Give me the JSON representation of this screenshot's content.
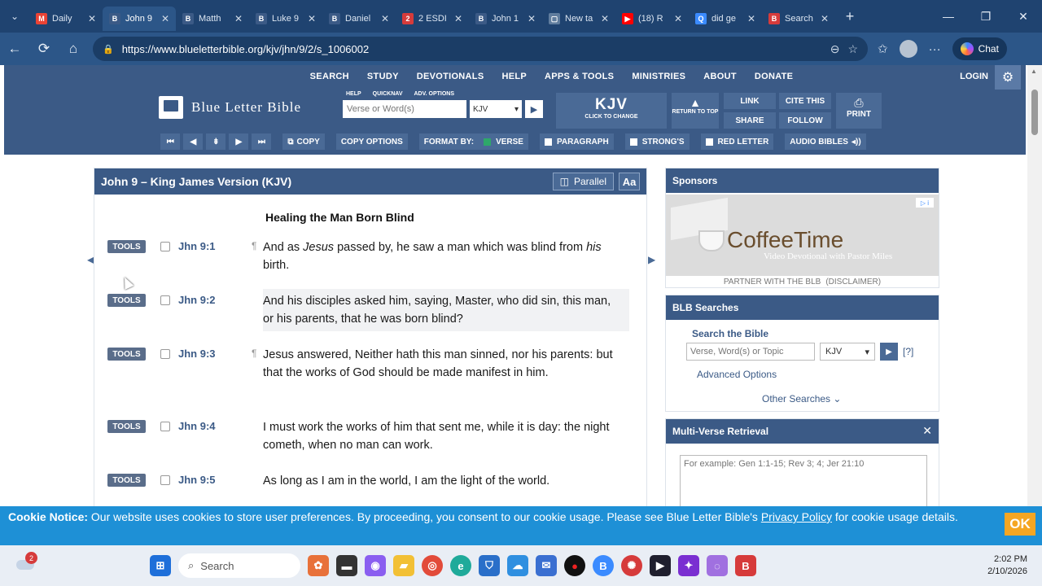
{
  "browser": {
    "tabs": [
      {
        "title": "Daily",
        "fav_color": "#ea4335",
        "fav_letter": "M"
      },
      {
        "title": "John 9",
        "fav_color": "#3b5a86",
        "fav_letter": "B",
        "active": true
      },
      {
        "title": "Matth",
        "fav_color": "#3b5a86",
        "fav_letter": "B"
      },
      {
        "title": "Luke 9",
        "fav_color": "#3b5a86",
        "fav_letter": "B"
      },
      {
        "title": "Daniel",
        "fav_color": "#3b5a86",
        "fav_letter": "B"
      },
      {
        "title": "2 ESDI",
        "fav_color": "#d63b3b",
        "fav_letter": "2"
      },
      {
        "title": "John 1",
        "fav_color": "#3b5a86",
        "fav_letter": "B"
      },
      {
        "title": "New ta",
        "fav_color": "#607d9e",
        "fav_letter": "▢"
      },
      {
        "title": "(18) R",
        "fav_color": "#ff0000",
        "fav_letter": "▶"
      },
      {
        "title": "did ge",
        "fav_color": "#3b8bff",
        "fav_letter": "Q"
      },
      {
        "title": "Search",
        "fav_color": "#d63b3b",
        "fav_letter": "B"
      }
    ],
    "url": "https://www.blueletterbible.org/kjv/jhn/9/2/s_1006002",
    "chat_label": "Chat"
  },
  "site": {
    "menu": [
      "SEARCH",
      "STUDY",
      "DEVOTIONALS",
      "HELP",
      "APPS & TOOLS",
      "MINISTRIES",
      "ABOUT",
      "DONATE"
    ],
    "login": "LOGIN",
    "logo_text": "Blue Letter Bible",
    "mini_links": [
      "HELP",
      "QUICKNAV",
      "ADV. OPTIONS"
    ],
    "verse_placeholder": "Verse or Word(s)",
    "version": "KJV",
    "kjv_big": "KJV",
    "kjv_small": "CLICK TO CHANGE",
    "return_top": "RETURN TO TOP",
    "link": "LINK",
    "cite": "CITE THIS",
    "share": "SHARE",
    "follow": "FOLLOW",
    "print": "PRINT",
    "toolbar": {
      "copy": "COPY",
      "copy_options": "COPY OPTIONS",
      "format_by": "FORMAT BY:",
      "verse": "VERSE",
      "paragraph": "PARAGRAPH",
      "strongs": "STRONG'S",
      "red_letter": "RED LETTER",
      "audio_bibles": "AUDIO BIBLES"
    }
  },
  "panel": {
    "title": "John 9 – King James Version (KJV)",
    "parallel": "Parallel",
    "aa": "Aa",
    "heading": "Healing the Man Born Blind",
    "tools_label": "TOOLS",
    "verses": [
      {
        "ref": "Jhn 9:1",
        "pilcrow": true,
        "html": "And as <i>Jesus</i> passed by, he saw a man which was blind from <i>his</i> birth.",
        "highlight": false
      },
      {
        "ref": "Jhn 9:2",
        "pilcrow": false,
        "html": "And his disciples asked him, saying, Master, who did sin, this man, or his parents, that he was born blind?",
        "highlight": true
      },
      {
        "ref": "Jhn 9:3",
        "pilcrow": true,
        "html": "Jesus answered, Neither hath this man sinned, nor his parents: but that the works of God should be made manifest in him.",
        "highlight": false
      },
      {
        "ref": "Jhn 9:4",
        "pilcrow": false,
        "html": "I must work the works of him that sent me, while it is day: the night cometh, when no man can work.",
        "highlight": false
      },
      {
        "ref": "Jhn 9:5",
        "pilcrow": false,
        "html": "As long as I am in the world, I am the light of the world.",
        "highlight": false
      }
    ]
  },
  "sidebar": {
    "sponsors": "Sponsors",
    "ad_title": "CoffeeTime",
    "ad_sub": "Video Devotional with Pastor Miles",
    "partner": "PARTNER WITH THE BLB",
    "disclaimer": "(DISCLAIMER)",
    "searches_title": "BLB Searches",
    "search_label": "Search the Bible",
    "search_placeholder": "Verse, Word(s) or Topic",
    "search_version": "KJV",
    "help": "[?]",
    "advanced": "Advanced Options",
    "other": "Other Searches",
    "mv_title": "Multi-Verse Retrieval",
    "mv_placeholder": "For example: Gen 1:1-15; Rev 3; 4; Jer 21:10"
  },
  "cookie": {
    "label": "Cookie Notice:",
    "text": " Our website uses cookies to store user preferences. By proceeding, you consent to our cookie usage. Please see Blue Letter Bible's ",
    "link": "Privacy Policy",
    "tail": " for cookie usage details.",
    "ok": "OK"
  },
  "taskbar": {
    "weather_badge": "2",
    "search": "Search",
    "time": "2:02 PM",
    "date": "2/10/2026"
  }
}
